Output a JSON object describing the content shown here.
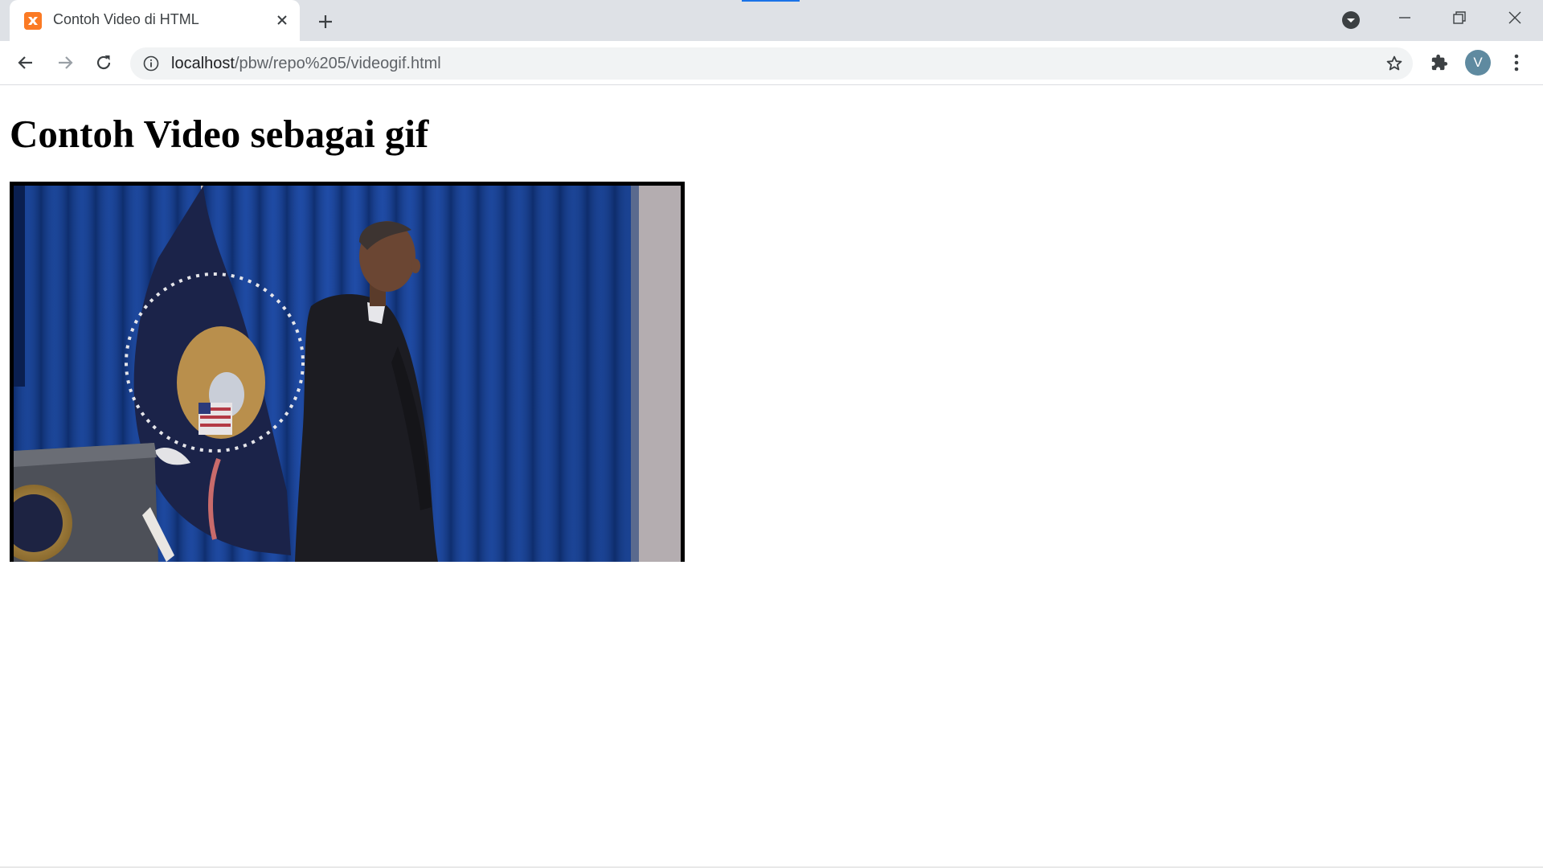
{
  "browser": {
    "tab": {
      "title": "Contoh Video di HTML",
      "favicon": "xampp-icon"
    },
    "address_bar": {
      "host": "localhost",
      "path": "/pbw/repo%205/videogif.html"
    },
    "profile_initial": "V",
    "colors": {
      "tab_strip": "#dee1e6",
      "omnibox": "#f1f3f4",
      "loading_accent": "#1a73e8",
      "favicon": "#fb7a24",
      "avatar": "#5f8aa0"
    }
  },
  "page": {
    "heading": "Contoh Video sebagai gif",
    "media": {
      "type": "animated gif frame",
      "subject": "presidential-flag-and-speaker"
    }
  }
}
